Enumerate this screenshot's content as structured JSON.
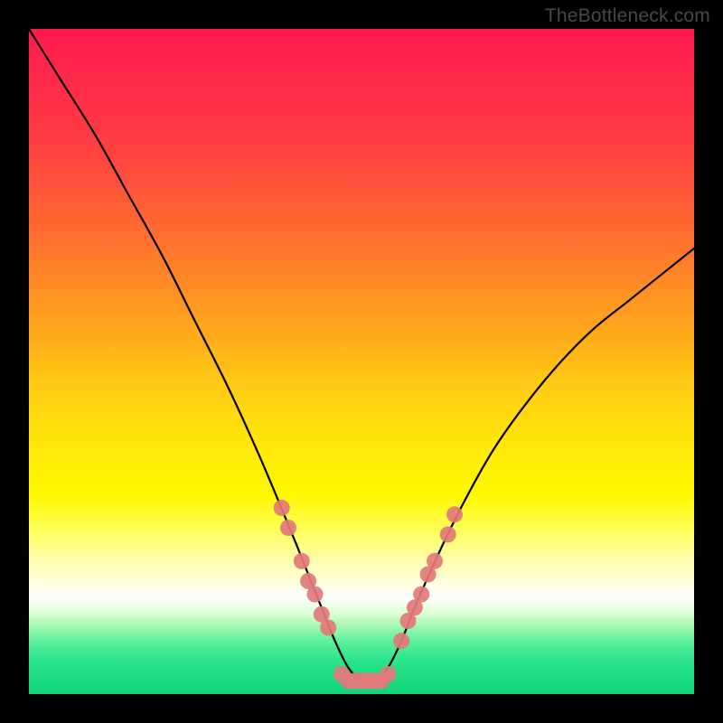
{
  "watermark": "TheBottleneck.com",
  "chart_data": {
    "type": "line",
    "title": "",
    "xlabel": "",
    "ylabel": "",
    "xlim": [
      0,
      100
    ],
    "ylim": [
      0,
      100
    ],
    "series": [
      {
        "name": "bottleneck-curve",
        "x": [
          0,
          5,
          10,
          15,
          20,
          25,
          30,
          35,
          40,
          42,
          44,
          46,
          48,
          50,
          52,
          54,
          56,
          58,
          62,
          66,
          70,
          75,
          80,
          85,
          90,
          95,
          100
        ],
        "values": [
          100,
          92,
          84,
          75,
          66,
          56,
          46,
          35,
          23,
          18,
          13,
          8,
          4,
          2,
          2,
          4,
          8,
          13,
          22,
          30,
          37,
          44,
          50,
          55,
          59,
          63,
          67
        ]
      }
    ],
    "markers": {
      "name": "highlighted-points",
      "color": "#e27a7a",
      "points": [
        {
          "x": 38,
          "y": 28
        },
        {
          "x": 39,
          "y": 25
        },
        {
          "x": 41,
          "y": 20
        },
        {
          "x": 42,
          "y": 17
        },
        {
          "x": 43,
          "y": 15
        },
        {
          "x": 44,
          "y": 12
        },
        {
          "x": 45,
          "y": 10
        },
        {
          "x": 47,
          "y": 3
        },
        {
          "x": 48,
          "y": 2
        },
        {
          "x": 49,
          "y": 2
        },
        {
          "x": 50,
          "y": 2
        },
        {
          "x": 51,
          "y": 2
        },
        {
          "x": 52,
          "y": 2
        },
        {
          "x": 53,
          "y": 2
        },
        {
          "x": 54,
          "y": 3
        },
        {
          "x": 56,
          "y": 8
        },
        {
          "x": 57,
          "y": 11
        },
        {
          "x": 58,
          "y": 13
        },
        {
          "x": 59,
          "y": 15
        },
        {
          "x": 60,
          "y": 18
        },
        {
          "x": 61,
          "y": 20
        },
        {
          "x": 63,
          "y": 24
        },
        {
          "x": 64,
          "y": 27
        }
      ]
    },
    "background_gradient": {
      "top": "#ff1a4d",
      "mid": "#ffe60a",
      "bottom": "#10d678"
    }
  }
}
